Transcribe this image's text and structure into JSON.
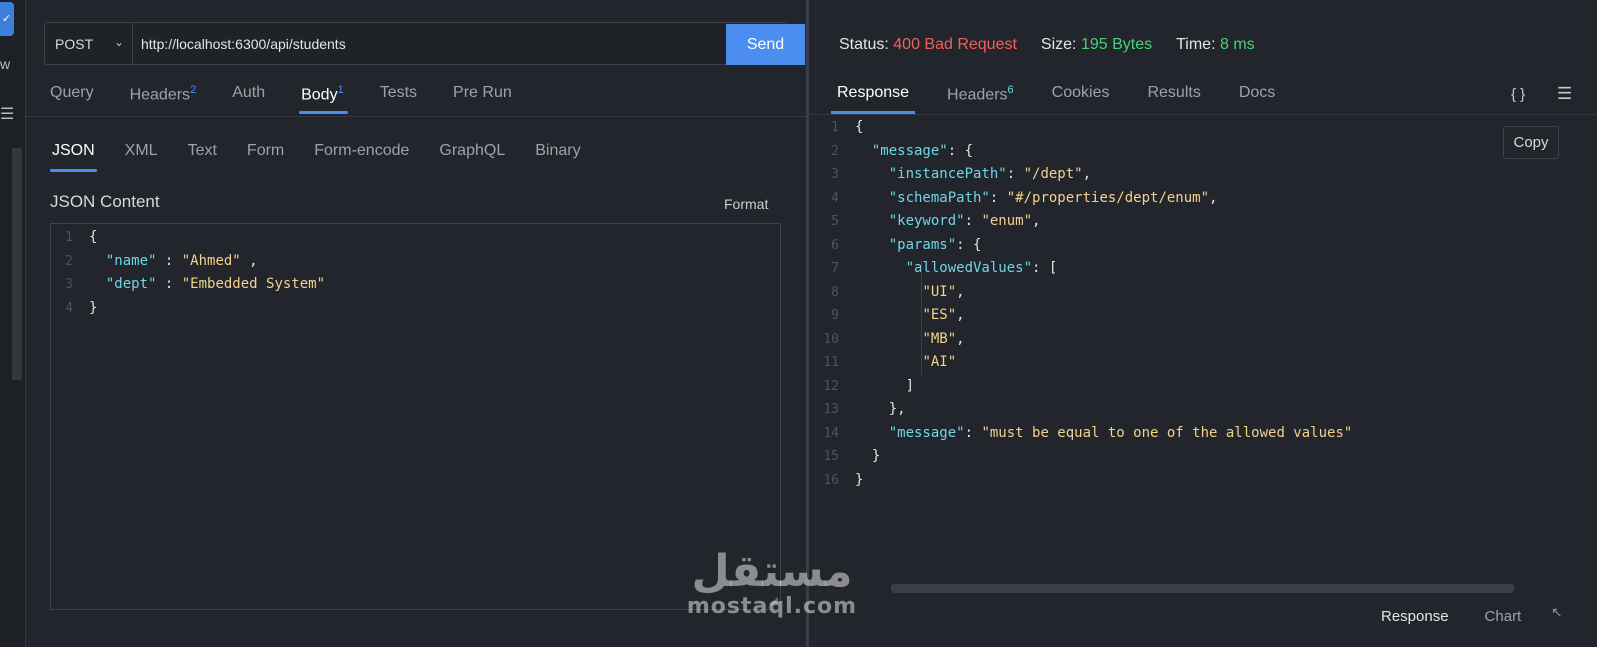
{
  "activity": {
    "badge": "✓",
    "letter": "w",
    "menu_icon": "menu-icon"
  },
  "request": {
    "method": "POST",
    "url": "http://localhost:6300/api/students",
    "send_label": "Send",
    "tabs": [
      {
        "label": "Query",
        "count": ""
      },
      {
        "label": "Headers",
        "count": "2"
      },
      {
        "label": "Auth",
        "count": ""
      },
      {
        "label": "Body",
        "count": "1"
      },
      {
        "label": "Tests",
        "count": ""
      },
      {
        "label": "Pre Run",
        "count": ""
      }
    ],
    "body_types": [
      "JSON",
      "XML",
      "Text",
      "Form",
      "Form-encode",
      "GraphQL",
      "Binary"
    ],
    "content_title": "JSON Content",
    "format_label": "Format",
    "code_lines": [
      {
        "n": "1",
        "parts": [
          [
            "p",
            "{"
          ]
        ]
      },
      {
        "n": "2",
        "parts": [
          [
            "p",
            "  "
          ],
          [
            "k",
            "\"name\""
          ],
          [
            "p",
            " : "
          ],
          [
            "s",
            "\"Ahmed\""
          ],
          [
            "p",
            " ,"
          ]
        ]
      },
      {
        "n": "3",
        "parts": [
          [
            "p",
            "  "
          ],
          [
            "k",
            "\"dept\""
          ],
          [
            "p",
            " : "
          ],
          [
            "s",
            "\"Embedded System\""
          ]
        ]
      },
      {
        "n": "4",
        "parts": [
          [
            "p",
            "}"
          ]
        ]
      }
    ]
  },
  "response": {
    "status_label": "Status:",
    "status_value": "400 Bad Request",
    "size_label": "Size:",
    "size_value": "195 Bytes",
    "time_label": "Time:",
    "time_value": "8 ms",
    "tabs": [
      {
        "label": "Response",
        "count": ""
      },
      {
        "label": "Headers",
        "count": "6"
      },
      {
        "label": "Cookies",
        "count": ""
      },
      {
        "label": "Results",
        "count": ""
      },
      {
        "label": "Docs",
        "count": ""
      }
    ],
    "braces_label": "{ }",
    "copy_label": "Copy",
    "code_lines": [
      {
        "n": "1",
        "parts": [
          [
            "p",
            "{"
          ]
        ]
      },
      {
        "n": "2",
        "parts": [
          [
            "p",
            "  "
          ],
          [
            "k",
            "\"message\""
          ],
          [
            "p",
            ": {"
          ]
        ]
      },
      {
        "n": "3",
        "parts": [
          [
            "p",
            "    "
          ],
          [
            "k",
            "\"instancePath\""
          ],
          [
            "p",
            ": "
          ],
          [
            "s",
            "\"/dept\""
          ],
          [
            "p",
            ","
          ]
        ]
      },
      {
        "n": "4",
        "parts": [
          [
            "p",
            "    "
          ],
          [
            "k",
            "\"schemaPath\""
          ],
          [
            "p",
            ": "
          ],
          [
            "s",
            "\"#/properties/dept/enum\""
          ],
          [
            "p",
            ","
          ]
        ]
      },
      {
        "n": "5",
        "parts": [
          [
            "p",
            "    "
          ],
          [
            "k",
            "\"keyword\""
          ],
          [
            "p",
            ": "
          ],
          [
            "s",
            "\"enum\""
          ],
          [
            "p",
            ","
          ]
        ]
      },
      {
        "n": "6",
        "parts": [
          [
            "p",
            "    "
          ],
          [
            "k",
            "\"params\""
          ],
          [
            "p",
            ": {"
          ]
        ]
      },
      {
        "n": "7",
        "parts": [
          [
            "p",
            "      "
          ],
          [
            "k",
            "\"allowedValues\""
          ],
          [
            "p",
            ": ["
          ]
        ]
      },
      {
        "n": "8",
        "parts": [
          [
            "p",
            "        "
          ],
          [
            "s",
            "\"UI\""
          ],
          [
            "p",
            ","
          ]
        ]
      },
      {
        "n": "9",
        "parts": [
          [
            "p",
            "        "
          ],
          [
            "s",
            "\"ES\""
          ],
          [
            "p",
            ","
          ]
        ]
      },
      {
        "n": "10",
        "parts": [
          [
            "p",
            "        "
          ],
          [
            "s",
            "\"MB\""
          ],
          [
            "p",
            ","
          ]
        ]
      },
      {
        "n": "11",
        "parts": [
          [
            "p",
            "        "
          ],
          [
            "s",
            "\"AI\""
          ]
        ]
      },
      {
        "n": "12",
        "parts": [
          [
            "p",
            "      ]"
          ]
        ]
      },
      {
        "n": "13",
        "parts": [
          [
            "p",
            "    },"
          ]
        ]
      },
      {
        "n": "14",
        "parts": [
          [
            "p",
            "    "
          ],
          [
            "k",
            "\"message\""
          ],
          [
            "p",
            ": "
          ],
          [
            "s",
            "\"must be equal to one of the allowed values\""
          ]
        ]
      },
      {
        "n": "15",
        "parts": [
          [
            "p",
            "  }"
          ]
        ]
      },
      {
        "n": "16",
        "parts": [
          [
            "p",
            "}"
          ]
        ]
      }
    ],
    "bottom_tabs": [
      "Response",
      "Chart"
    ]
  },
  "watermark": {
    "logo": "مستقل",
    "domain": "mostaql.com"
  },
  "colors": {
    "accent": "#4b8ef0",
    "error": "#f0605a",
    "success": "#49d17a",
    "key": "#6fd6e6",
    "string": "#f2d28c"
  }
}
